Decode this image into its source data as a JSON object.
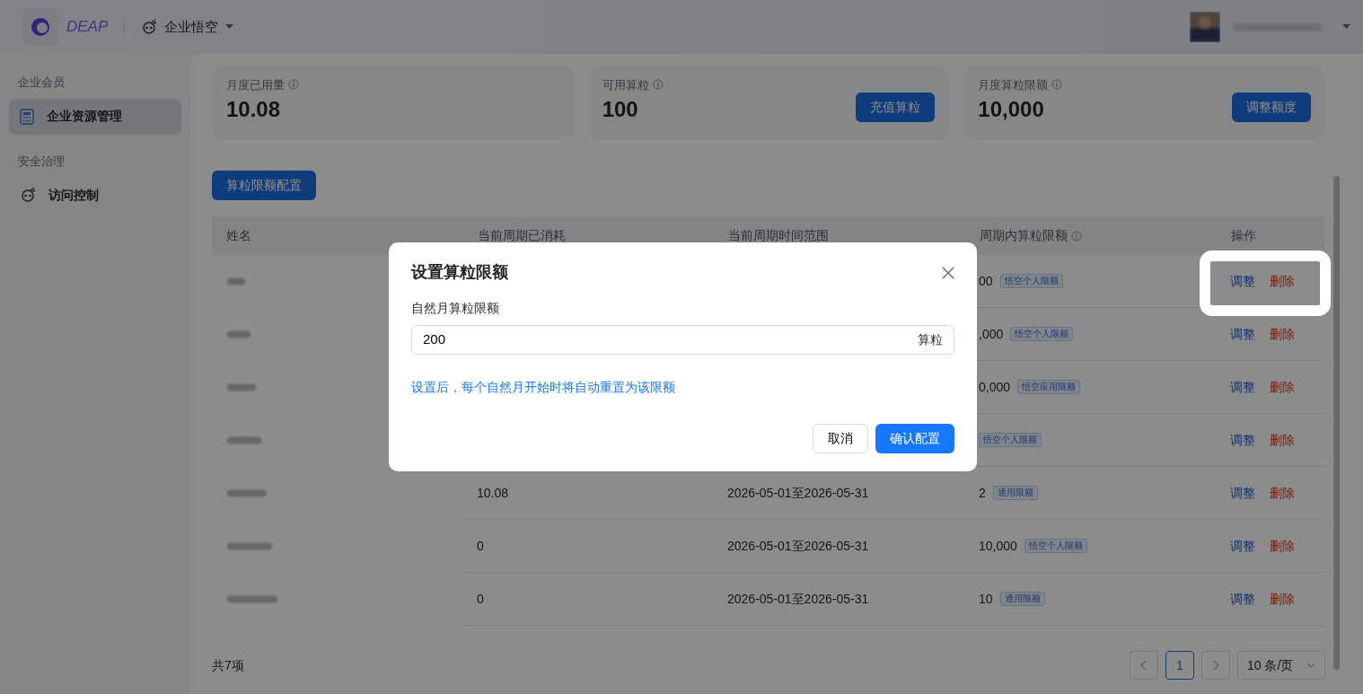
{
  "topbar": {
    "brand": "DEAP",
    "workspace": "企业悟空"
  },
  "sidebar": {
    "sections": [
      {
        "title": "企业会员",
        "items": [
          {
            "label": "企业资源管理",
            "selected": true
          }
        ]
      },
      {
        "title": "安全治理",
        "items": [
          {
            "label": "访问控制",
            "selected": false
          }
        ]
      }
    ]
  },
  "stats": [
    {
      "label": "月度已用量",
      "value": "10.08"
    },
    {
      "label": "可用算粒",
      "value": "100",
      "action": "充值算粒"
    },
    {
      "label": "月度算粒限额",
      "value": "10,000",
      "action": "调整额度"
    }
  ],
  "config_button": "算粒限额配置",
  "table": {
    "columns": [
      {
        "label": "姓名",
        "info": false
      },
      {
        "label": "当前周期已消耗",
        "info": false
      },
      {
        "label": "当前周期时间范围",
        "info": false
      },
      {
        "label": "周期内算粒限额",
        "info": true
      },
      {
        "label": "操作",
        "info": false
      }
    ],
    "rows": [
      {
        "limit": "00",
        "tag": "悟空个人限额",
        "actions": [
          "调整",
          "删除"
        ],
        "highlighted": true
      },
      {
        "limit": ",000",
        "tag": "悟空个人限额",
        "actions": [
          "调整",
          "删除"
        ],
        "highlighted": false
      },
      {
        "limit": "0,000",
        "tag": "悟空应用限额",
        "actions": [
          "调整",
          "删除"
        ],
        "highlighted": false
      },
      {
        "tag": "悟空个人限额",
        "actions": [
          "调整",
          "删除"
        ],
        "highlighted": false
      },
      {
        "consumed": "10.08",
        "range": "2026-05-01至2026-05-31",
        "limit": "2",
        "tag": "通用限额",
        "actions": [
          "调整",
          "删除"
        ],
        "highlighted": false
      },
      {
        "consumed": "0",
        "range": "2026-05-01至2026-05-31",
        "limit": "10,000",
        "tag": "悟空个人限额",
        "actions": [
          "调整",
          "删除"
        ],
        "highlighted": false
      },
      {
        "consumed": "0",
        "range": "2026-05-01至2026-05-31",
        "limit": "10",
        "tag": "通用限额",
        "actions": [
          "调整",
          "删除"
        ],
        "highlighted": false
      }
    ]
  },
  "footer": {
    "total": "共7项",
    "pages": [
      {
        "label": "1",
        "selected": true
      }
    ],
    "page_size": "10 条/页"
  },
  "modal": {
    "title": "设置算粒限额",
    "field_label": "自然月算粒限额",
    "value": "200",
    "unit": "算粒",
    "hint": "设置后，每个自然月开始时将自动重置为该限额",
    "buttons": [
      {
        "label": "取消",
        "kind": "default"
      },
      {
        "label": "确认配置",
        "kind": "primary"
      }
    ]
  }
}
